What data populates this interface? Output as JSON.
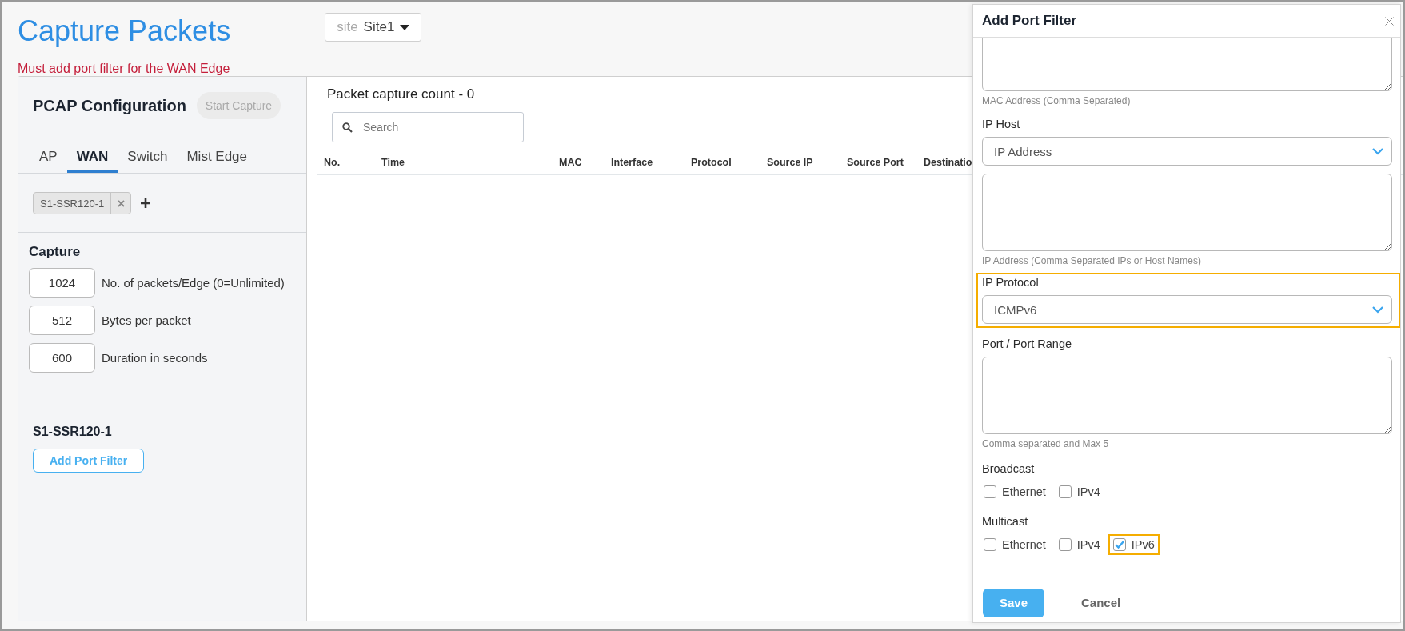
{
  "page": {
    "title": "Capture Packets",
    "site_selector": {
      "prefix": "site",
      "value": "Site1"
    },
    "error": "Must add port filter for the WAN Edge"
  },
  "config": {
    "title": "PCAP Configuration",
    "start_button": {
      "label": "Start Capture",
      "disabled": true
    },
    "tabs": [
      {
        "label": "AP",
        "selected": false
      },
      {
        "label": "WAN",
        "selected": true
      },
      {
        "label": "Switch",
        "selected": false
      },
      {
        "label": "Mist Edge",
        "selected": false
      }
    ],
    "devices": [
      {
        "label": "S1-SSR120-1"
      }
    ],
    "capture": {
      "title": "Capture",
      "fields": [
        {
          "value": "1024",
          "label": "No. of packets/Edge (0=Unlimited)"
        },
        {
          "value": "512",
          "label": "Bytes per packet"
        },
        {
          "value": "600",
          "label": "Duration in seconds"
        }
      ]
    },
    "edges": [
      {
        "name": "S1-SSR120-1",
        "button": "Add Port Filter"
      }
    ]
  },
  "packets": {
    "count_label": "Packet capture count - 0",
    "search": {
      "placeholder": "Search"
    },
    "columns": [
      "No.",
      "Time",
      "MAC",
      "Interface",
      "Protocol",
      "Source IP",
      "Source Port",
      "Destinatio"
    ]
  },
  "drawer": {
    "title": "Add Port Filter",
    "fields": [
      {
        "kind": "textarea",
        "hint": "MAC Address (Comma Separated)",
        "highlighted": false
      },
      {
        "kind": "select",
        "label": "IP Host",
        "value": "IP Address",
        "highlighted": false
      },
      {
        "kind": "textarea",
        "hint": "IP Address (Comma Separated IPs or Host Names)",
        "highlighted": false
      },
      {
        "kind": "select",
        "label": "IP Protocol",
        "value": "ICMPv6",
        "highlighted": true
      },
      {
        "kind": "textarea",
        "label": "Port / Port Range",
        "hint": "Comma separated and Max 5",
        "highlighted": false
      }
    ],
    "checkbox_groups": [
      {
        "label": "Broadcast",
        "options": [
          {
            "label": "Ethernet",
            "checked": false,
            "highlighted": false
          },
          {
            "label": "IPv4",
            "checked": false,
            "highlighted": false
          }
        ]
      },
      {
        "label": "Multicast",
        "options": [
          {
            "label": "Ethernet",
            "checked": false,
            "highlighted": false
          },
          {
            "label": "IPv4",
            "checked": false,
            "highlighted": false
          },
          {
            "label": "IPv6",
            "checked": true,
            "highlighted": true
          }
        ]
      }
    ],
    "buttons": [
      {
        "label": "Save",
        "kind": "primary"
      },
      {
        "label": "Cancel",
        "kind": "secondary"
      }
    ]
  }
}
